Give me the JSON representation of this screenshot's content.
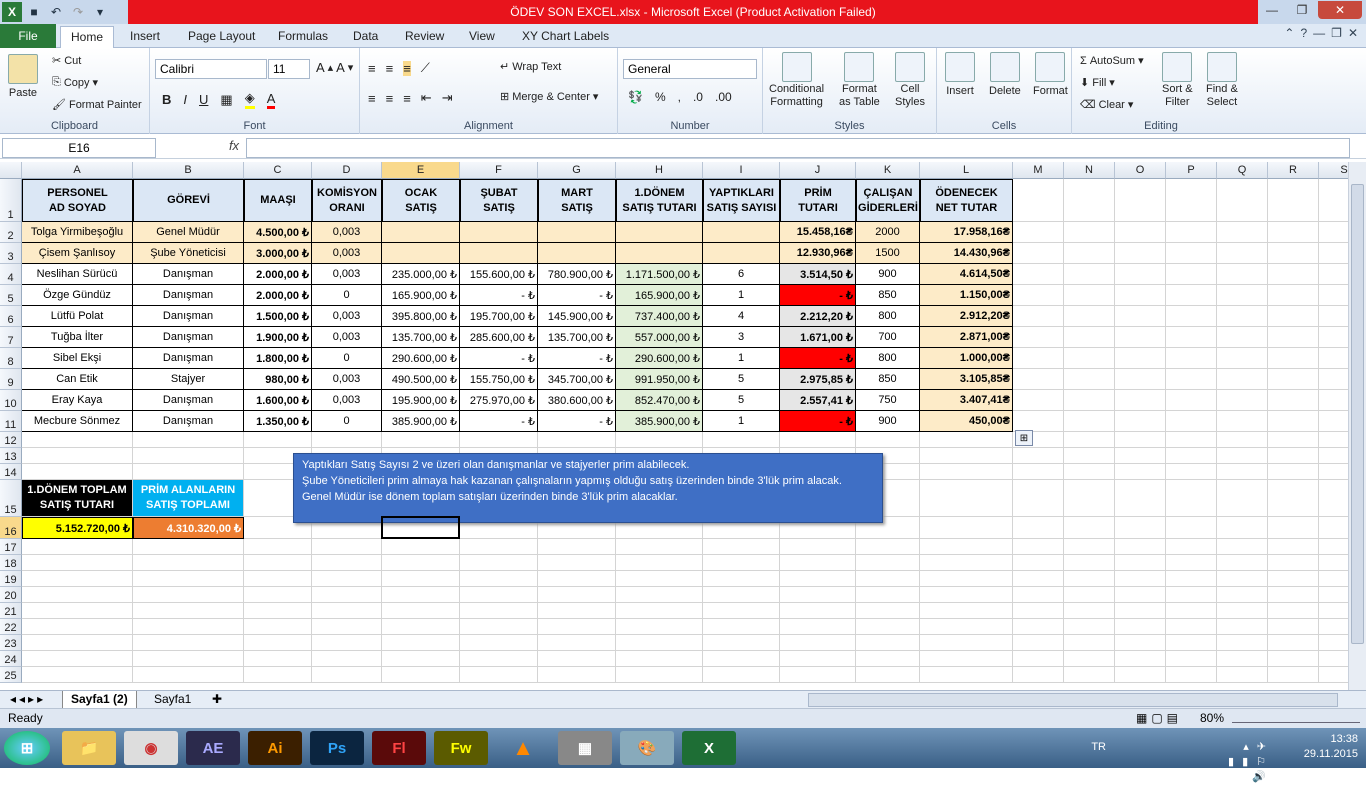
{
  "window": {
    "title": "ÖDEV SON EXCEL.xlsx  -  Microsoft Excel (Product Activation Failed)"
  },
  "tabs": [
    "File",
    "Home",
    "Insert",
    "Page Layout",
    "Formulas",
    "Data",
    "Review",
    "View",
    "XY Chart Labels"
  ],
  "ribbon": {
    "clipboard": {
      "label": "Clipboard",
      "paste": "Paste",
      "cut": "Cut",
      "copy": "Copy",
      "format_painter": "Format Painter"
    },
    "font": {
      "label": "Font",
      "name": "Calibri",
      "size": "11"
    },
    "alignment": {
      "label": "Alignment",
      "wrap": "Wrap Text",
      "merge": "Merge & Center"
    },
    "number": {
      "label": "Number",
      "format": "General"
    },
    "styles": {
      "label": "Styles",
      "conditional": "Conditional",
      "conditional2": "Formatting",
      "format_table": "Format",
      "format_table2": "as Table",
      "cell_styles": "Cell",
      "cell_styles2": "Styles"
    },
    "cells": {
      "label": "Cells",
      "insert": "Insert",
      "delete": "Delete",
      "format": "Format"
    },
    "editing": {
      "label": "Editing",
      "autosum": "AutoSum",
      "fill": "Fill",
      "clear": "Clear",
      "sort": "Sort &",
      "sort2": "Filter",
      "find": "Find &",
      "find2": "Select"
    }
  },
  "formula_bar": {
    "name_box": "E16",
    "fx": "fx",
    "content": ""
  },
  "columns": [
    "A",
    "B",
    "C",
    "D",
    "E",
    "F",
    "G",
    "H",
    "I",
    "J",
    "K",
    "L",
    "M",
    "N",
    "O",
    "P",
    "Q",
    "R",
    "S"
  ],
  "rows": [
    "1",
    "2",
    "3",
    "4",
    "5",
    "6",
    "7",
    "8",
    "9",
    "10",
    "11",
    "12",
    "13",
    "14",
    "15",
    "16",
    "17",
    "18",
    "19",
    "20",
    "21",
    "22",
    "23",
    "24",
    "25"
  ],
  "headers": [
    "PERSONEL\nAD SOYAD",
    "GÖREVİ",
    "MAAŞI",
    "KOMİSYON\nORANI",
    "OCAK\nSATIŞ",
    "ŞUBAT\nSATIŞ",
    "MART\nSATIŞ",
    "1.DÖNEM\nSATIŞ TUTARI",
    "YAPTIKLARI\nSATIŞ SAYISI",
    "PRİM\nTUTARI",
    "ÇALIŞAN\nGİDERLERİ",
    "ÖDENECEK\nNET TUTAR"
  ],
  "table": [
    [
      "Tolga Yirmibeşoğlu",
      "Genel Müdür",
      "4.500,00 ₺",
      "0,003",
      "",
      "",
      "",
      "",
      "",
      "15.458,16₴",
      "2000",
      "17.958,16₴"
    ],
    [
      "Çisem Şanlısoy",
      "Şube Yöneticisi",
      "3.000,00 ₺",
      "0,003",
      "",
      "",
      "",
      "",
      "",
      "12.930,96₴",
      "1500",
      "14.430,96₴"
    ],
    [
      "Neslihan Sürücü",
      "Danışman",
      "2.000,00 ₺",
      "0,003",
      "235.000,00 ₺",
      "155.600,00 ₺",
      "780.900,00 ₺",
      "1.171.500,00 ₺",
      "6",
      "3.514,50 ₺",
      "900",
      "4.614,50₴"
    ],
    [
      "Özge Gündüz",
      "Danışman",
      "2.000,00 ₺",
      "0",
      "165.900,00 ₺",
      "-    ₺",
      "-    ₺",
      "165.900,00 ₺",
      "1",
      "-    ₺",
      "850",
      "1.150,00₴"
    ],
    [
      "Lütfü Polat",
      "Danışman",
      "1.500,00 ₺",
      "0,003",
      "395.800,00 ₺",
      "195.700,00 ₺",
      "145.900,00 ₺",
      "737.400,00 ₺",
      "4",
      "2.212,20 ₺",
      "800",
      "2.912,20₴"
    ],
    [
      "Tuğba İlter",
      "Danışman",
      "1.900,00 ₺",
      "0,003",
      "135.700,00 ₺",
      "285.600,00 ₺",
      "135.700,00 ₺",
      "557.000,00 ₺",
      "3",
      "1.671,00 ₺",
      "700",
      "2.871,00₴"
    ],
    [
      "Sibel Ekşi",
      "Danışman",
      "1.800,00 ₺",
      "0",
      "290.600,00 ₺",
      "-    ₺",
      "-    ₺",
      "290.600,00 ₺",
      "1",
      "-    ₺",
      "800",
      "1.000,00₴"
    ],
    [
      "Can Etik",
      "Stajyer",
      "980,00 ₺",
      "0,003",
      "490.500,00 ₺",
      "155.750,00 ₺",
      "345.700,00 ₺",
      "991.950,00 ₺",
      "5",
      "2.975,85 ₺",
      "850",
      "3.105,85₴"
    ],
    [
      "Eray Kaya",
      "Danışman",
      "1.600,00 ₺",
      "0,003",
      "195.900,00 ₺",
      "275.970,00 ₺",
      "380.600,00 ₺",
      "852.470,00 ₺",
      "5",
      "2.557,41 ₺",
      "750",
      "3.407,41₴"
    ],
    [
      "Mecbure Sönmez",
      "Danışman",
      "1.350,00 ₺",
      "0",
      "385.900,00 ₺",
      "-    ₺",
      "-    ₺",
      "385.900,00 ₺",
      "1",
      "-    ₺",
      "900",
      "450,00₴"
    ]
  ],
  "summary": {
    "total_label": "1.DÖNEM TOPLAM\nSATIŞ TUTARI",
    "prim_label": "PRİM ALANLARIN\nSATIŞ TOPLAMI",
    "total_value": "5.152.720,00 ₺",
    "prim_value": "4.310.320,00 ₺"
  },
  "callout": [
    "Yaptıkları Satış Sayısı 2 ve üzeri olan danışmanlar ve stajyerler prim alabilecek.",
    "Şube Yöneticileri prim almaya hak kazanan çalışnaların yapmış olduğu satış üzerinden binde 3'lük prim alacak.",
    "Genel Müdür ise dönem toplam satışları üzerinden binde 3'lük prim alacaklar."
  ],
  "sheet_tabs": [
    "Sayfa1 (2)",
    "Sayfa1"
  ],
  "status": {
    "ready": "Ready",
    "zoom": "80%"
  },
  "taskbar": {
    "lang": "TR",
    "time": "13:38",
    "date": "29.11.2015",
    "apps": [
      "AE",
      "Ai",
      "Ps",
      "Fl",
      "Fw"
    ]
  }
}
